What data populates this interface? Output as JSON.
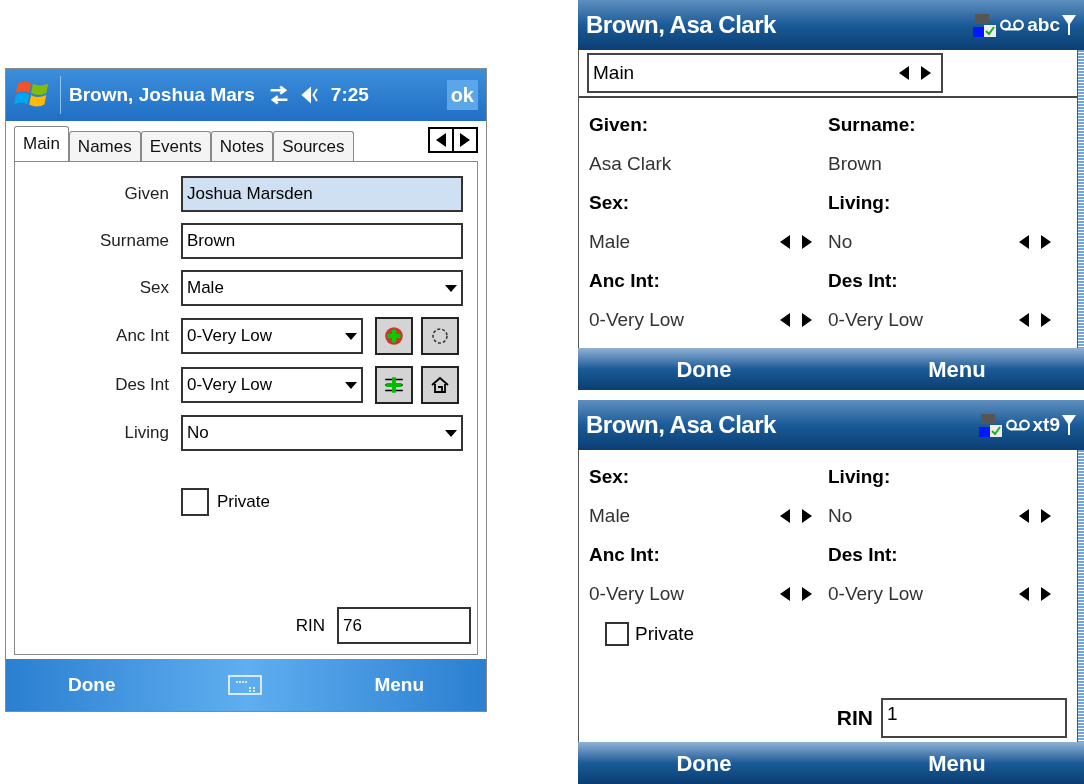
{
  "pocket_pc": {
    "title": "Brown, Joshua Mars",
    "time": "7:25",
    "ok": "ok",
    "tabs": [
      {
        "label": "Main",
        "selected": true
      },
      {
        "label": "Names",
        "selected": false
      },
      {
        "label": "Events",
        "selected": false
      },
      {
        "label": "Notes",
        "selected": false
      },
      {
        "label": "Sources",
        "selected": false
      }
    ],
    "fields": [
      {
        "kind": "text",
        "label": "Given",
        "value": "Joshua Marsden",
        "focused": true
      },
      {
        "kind": "text",
        "label": "Surname",
        "value": "Brown",
        "focused": false
      },
      {
        "kind": "dropdown",
        "label": "Sex",
        "value": "Male",
        "focused": false
      },
      {
        "kind": "dropdown_buttons",
        "label": "Anc Int",
        "value": "0-Very Low",
        "focused": false
      },
      {
        "kind": "dropdown_buttons",
        "label": "Des Int",
        "value": "0-Very Low",
        "focused": false
      },
      {
        "kind": "dropdown",
        "label": "Living",
        "value": "No",
        "focused": false
      }
    ],
    "private": {
      "label": "Private",
      "checked": false
    },
    "rin": {
      "label": "RIN",
      "value": "76"
    },
    "softkeys": [
      "Done",
      "Menu"
    ]
  },
  "smartphone_screens": [
    {
      "title": "Brown, Asa Clark",
      "input_mode": "abc",
      "tab_picker": "Main",
      "fields": [
        {
          "kind": "text",
          "label": "Given:",
          "value": "Asa Clark"
        },
        {
          "kind": "text",
          "label": "Surname:",
          "value": "Brown"
        },
        {
          "kind": "spinner",
          "label": "Sex:",
          "value": "Male"
        },
        {
          "kind": "spinner",
          "label": "Living:",
          "value": "No"
        },
        {
          "kind": "spinner",
          "label": "Anc Int:",
          "value": "0-Very Low"
        },
        {
          "kind": "spinner",
          "label": "Des Int:",
          "value": "0-Very Low"
        }
      ],
      "softkeys": [
        "Done",
        "Menu"
      ]
    },
    {
      "title": "Brown, Asa Clark",
      "input_mode": "xt9",
      "fields": [
        {
          "kind": "spinner",
          "label": "Sex:",
          "value": "Male"
        },
        {
          "kind": "spinner",
          "label": "Living:",
          "value": "No"
        },
        {
          "kind": "spinner",
          "label": "Anc Int:",
          "value": "0-Very Low"
        },
        {
          "kind": "spinner",
          "label": "Des Int:",
          "value": "0-Very Low"
        }
      ],
      "private": {
        "label": "Private",
        "checked": false
      },
      "rin": {
        "label": "RIN",
        "value": "1"
      },
      "softkeys": [
        "Done",
        "Menu"
      ]
    }
  ]
}
